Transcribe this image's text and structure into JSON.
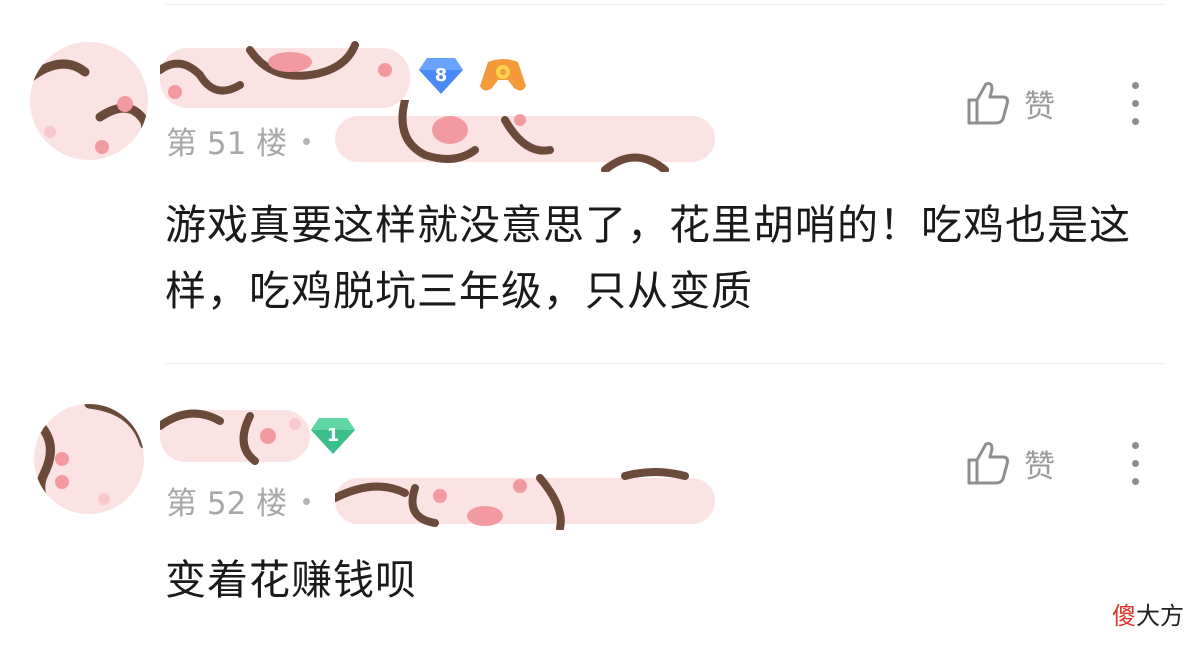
{
  "comments": [
    {
      "floor_label": "第 51 楼",
      "level_badge": "8",
      "level_color": "#4a8af4",
      "extra_badge": "gaming-controller-badge",
      "like_label": "赞",
      "text": "游戏真要这样就没意思了，花里胡哨的！吃鸡也是这样，吃鸡脱坑三年级，只从变质"
    },
    {
      "floor_label": "第 52 楼",
      "level_badge": "1",
      "level_color": "#3bbf8a",
      "like_label": "赞",
      "text": "变着花赚钱呗"
    }
  ],
  "watermark": {
    "red_part": "傻",
    "dark_part": "大方"
  },
  "colors": {
    "mask_pink": "#f9d6d6",
    "mask_brown": "#6b4a3a",
    "mask_pad": "#f39aa0"
  }
}
